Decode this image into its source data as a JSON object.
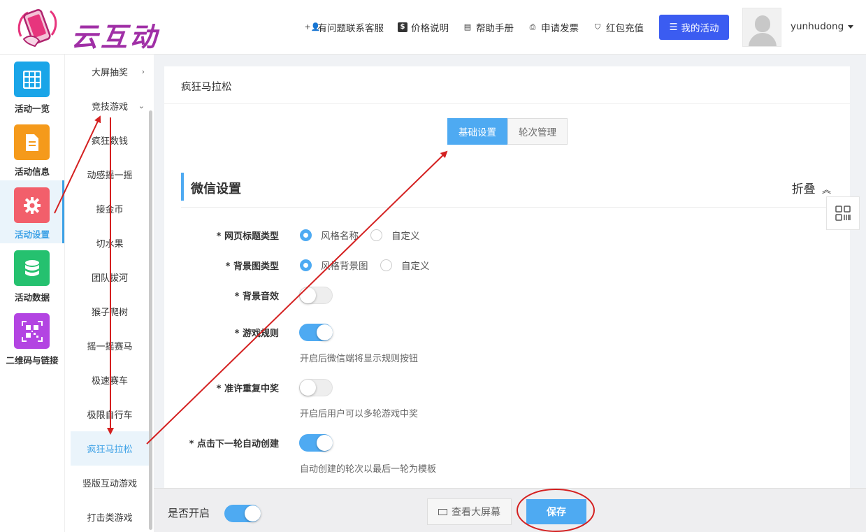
{
  "brand": {
    "name": "云互动"
  },
  "topnav": {
    "support": "有问题联系客服",
    "pricing": "价格说明",
    "manual": "帮助手册",
    "invoice": "申请发票",
    "redpacket": "红包充值",
    "my_activity": "我的活动"
  },
  "user": {
    "name": "yunhudong"
  },
  "leftnav": [
    {
      "label": "活动一览",
      "icon": "grid-icon",
      "color": "#1aa5e8"
    },
    {
      "label": "活动信息",
      "icon": "document-icon",
      "color": "#f59a1b"
    },
    {
      "label": "活动设置",
      "icon": "gear-icon",
      "color": "#f25f6b"
    },
    {
      "label": "活动数据",
      "icon": "database-icon",
      "color": "#25c16f"
    },
    {
      "label": "二维码与链接",
      "icon": "qrcode-icon",
      "color": "#b344e2"
    }
  ],
  "subnav": {
    "groups": [
      {
        "label": "大屏抽奖",
        "chevron": "›"
      },
      {
        "label": "竞技游戏",
        "chevron": "⌄"
      }
    ],
    "items": [
      "疯狂数钱",
      "动感摇一摇",
      "接金币",
      "切水果",
      "团队拔河",
      "猴子爬树",
      "摇一摇赛马",
      "极速赛车",
      "极限自行车",
      "疯狂马拉松",
      "竖版互动游戏",
      "打击类游戏"
    ]
  },
  "main": {
    "title": "疯狂马拉松",
    "tabs": [
      "基础设置",
      "轮次管理"
    ],
    "section": {
      "title": "微信设置",
      "fold": "折叠"
    },
    "fields": {
      "page_title_type": {
        "label": "* 网页标题类型",
        "option1": "风格名称",
        "option2": "自定义"
      },
      "bg_type": {
        "label": "* 背景图类型",
        "option1": "风格背景图",
        "option2": "自定义"
      },
      "bg_sound": {
        "label": "* 背景音效"
      },
      "game_rules": {
        "label": "* 游戏规则",
        "hint": "开启后微信端将显示规则按钮"
      },
      "repeat_win": {
        "label": "* 准许重复中奖",
        "hint": "开启后用户可以多轮游戏中奖"
      },
      "auto_create": {
        "label": "* 点击下一轮自动创建",
        "hint": "自动创建的轮次以最后一轮为模板"
      }
    }
  },
  "bottom": {
    "open_label": "是否开启",
    "view_screen": "查看大屏幕",
    "save": "保存"
  },
  "colors": {
    "accent": "#4eaaf2",
    "primary_btn": "#3b5cf1",
    "annotation": "#d42020"
  }
}
